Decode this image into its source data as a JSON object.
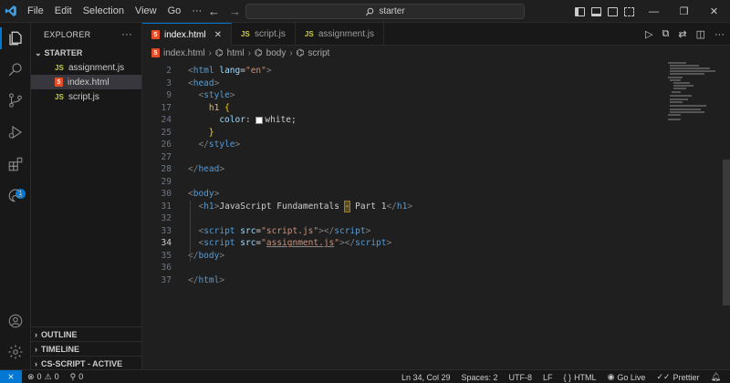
{
  "menu": [
    "File",
    "Edit",
    "Selection",
    "View",
    "Go",
    "···"
  ],
  "search": {
    "text": "starter"
  },
  "explorer": {
    "title": "EXPLORER",
    "more": "···",
    "folder": "STARTER",
    "files": [
      {
        "name": "assignment.js",
        "type": "js"
      },
      {
        "name": "index.html",
        "type": "html",
        "selected": true
      },
      {
        "name": "script.js",
        "type": "js"
      }
    ],
    "panels": [
      "OUTLINE",
      "TIMELINE",
      "CS-SCRIPT - ACTIVE"
    ]
  },
  "tabs": [
    {
      "label": "index.html",
      "type": "html",
      "active": true
    },
    {
      "label": "script.js",
      "type": "js"
    },
    {
      "label": "assignment.js",
      "type": "js"
    }
  ],
  "breadcrumb": [
    "index.html",
    "html",
    "body",
    "script"
  ],
  "extensions_badge": "1",
  "code_lines": [
    {
      "n": "2",
      "html": "<span class='punct'>&lt;</span><span class='tag'>html</span> <span class='attr'>lang</span>=<span class='str'>\"en\"</span><span class='punct'>&gt;</span>"
    },
    {
      "n": "3",
      "html": "<span class='punct'>&lt;</span><span class='tag'>head</span><span class='punct'>&gt;</span>"
    },
    {
      "n": "9",
      "html": "  <span class='punct'>&lt;</span><span class='tag'>style</span><span class='punct'>&gt;</span>"
    },
    {
      "n": "17",
      "html": "    <span class='sel'>h1</span> <span class='brace'>{</span>"
    },
    {
      "n": "24",
      "html": "      <span class='prop'>color</span>: <span class='swatch'></span><span class='text'>white</span>;"
    },
    {
      "n": "25",
      "html": "    <span class='brace'>}</span>"
    },
    {
      "n": "26",
      "html": "  <span class='punct'>&lt;/</span><span class='tag'>style</span><span class='punct'>&gt;</span>"
    },
    {
      "n": "27",
      "html": ""
    },
    {
      "n": "28",
      "html": "<span class='punct'>&lt;/</span><span class='tag'>head</span><span class='punct'>&gt;</span>"
    },
    {
      "n": "29",
      "html": ""
    },
    {
      "n": "30",
      "html": "<span class='punct'>&lt;</span><span class='tag'>body</span><span class='punct'>&gt;</span>"
    },
    {
      "n": "31",
      "html": "  <span class='punct'>&lt;</span><span class='tag'>h1</span><span class='punct'>&gt;</span><span class='text'>JavaScript Fundamentals </span><span class='hl'>-</span><span class='text'> Part 1</span><span class='punct'>&lt;/</span><span class='tag'>h1</span><span class='punct'>&gt;</span>"
    },
    {
      "n": "32",
      "html": ""
    },
    {
      "n": "33",
      "html": "  <span class='punct'>&lt;</span><span class='tag'>script</span> <span class='attr'>src</span>=<span class='str'>\"script.js\"</span><span class='punct'>&gt;&lt;/</span><span class='tag'>script</span><span class='punct'>&gt;</span>"
    },
    {
      "n": "34",
      "html": "  <span class='punct'>&lt;</span><span class='tag'>script</span> <span class='attr'>src</span>=<span class='str'>\"<span class='underline'>assignment.js</span>\"</span><span class='punct'>&gt;&lt;/</span><span class='tag'>script</span><span class='punct'>&gt;</span>",
      "current": true
    },
    {
      "n": "35",
      "html": "<span class='punct'>&lt;/</span><span class='tag'>body</span><span class='punct'>&gt;</span>"
    },
    {
      "n": "36",
      "html": ""
    },
    {
      "n": "37",
      "html": "<span class='punct'>&lt;/</span><span class='tag'>html</span><span class='punct'>&gt;</span>"
    }
  ],
  "status": {
    "errors": "0",
    "warnings": "0",
    "ports": "0",
    "position": "Ln 34, Col 29",
    "spaces": "Spaces: 2",
    "encoding": "UTF-8",
    "eol": "LF",
    "language": "HTML",
    "golive": "Go Live",
    "prettier": "Prettier"
  },
  "colors": {
    "accent": "#0078d4",
    "bg": "#1f1f1f",
    "sidebar": "#181818"
  }
}
